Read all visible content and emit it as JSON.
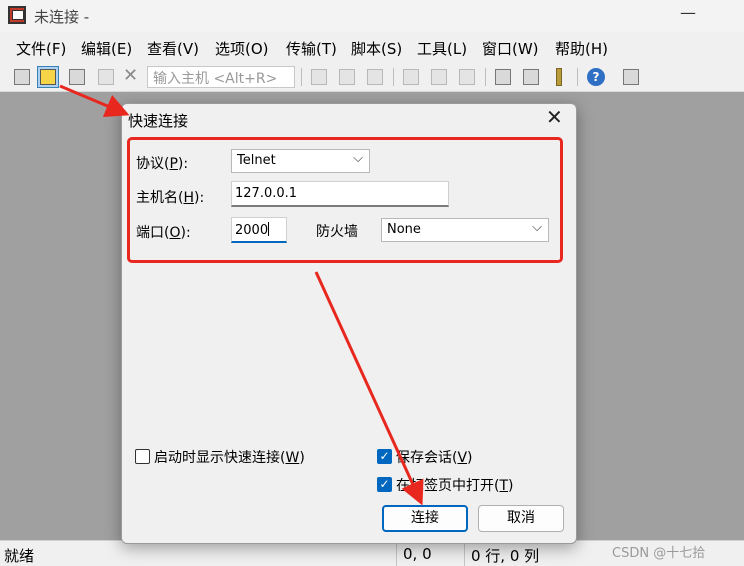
{
  "window": {
    "title": "未连接 -",
    "minimize_glyph": "—"
  },
  "menu": [
    "文件(F)",
    "编辑(E)",
    "查看(V)",
    "选项(O)",
    "传输(T)",
    "脚本(S)",
    "工具(L)",
    "窗口(W)",
    "帮助(H)"
  ],
  "toolbar": {
    "host_placeholder": "输入主机 <Alt+R>",
    "icons": [
      "connect-icon",
      "quick-connect-icon",
      "connect-in-tab-icon",
      "reconnect-icon",
      "disconnect-icon",
      "copy-icon",
      "paste-icon",
      "find-icon",
      "print-setup-icon",
      "print-icon",
      "print-screen-icon",
      "session-options-icon",
      "global-options-icon",
      "keymap-icon",
      "help-icon",
      "about-icon"
    ]
  },
  "dialog": {
    "title": "快速连接",
    "close_glyph": "✕",
    "protocol_label": "协议(",
    "protocol_key": "P",
    "protocol_label_end": "):",
    "protocol_value": "Telnet",
    "host_label": "主机名(",
    "host_key": "H",
    "host_label_end": "):",
    "host_value": "127.0.0.1",
    "port_label": "端口(",
    "port_key": "O",
    "port_label_end": "):",
    "port_value": "2000",
    "firewall_label": "防火墙",
    "firewall_value": "None",
    "show_on_startup_label": "启动时显示快速连接(",
    "show_on_startup_key": "W",
    "show_on_startup_label_end": ")",
    "show_on_startup_checked": false,
    "save_session_label": "保存会话(",
    "save_session_key": "V",
    "save_session_label_end": ")",
    "save_session_checked": true,
    "open_in_tab_label": "在标签页中打开(",
    "open_in_tab_key": "T",
    "open_in_tab_label_end": ")",
    "open_in_tab_checked": true,
    "connect_button": "连接",
    "cancel_button": "取消"
  },
  "status": {
    "ready": "就绪",
    "cursor": "0, 0",
    "size": "0 行, 0 列"
  },
  "watermark": "CSDN @十七拾",
  "colors": {
    "annotation": "#e8281f",
    "accent": "#0067c0"
  }
}
